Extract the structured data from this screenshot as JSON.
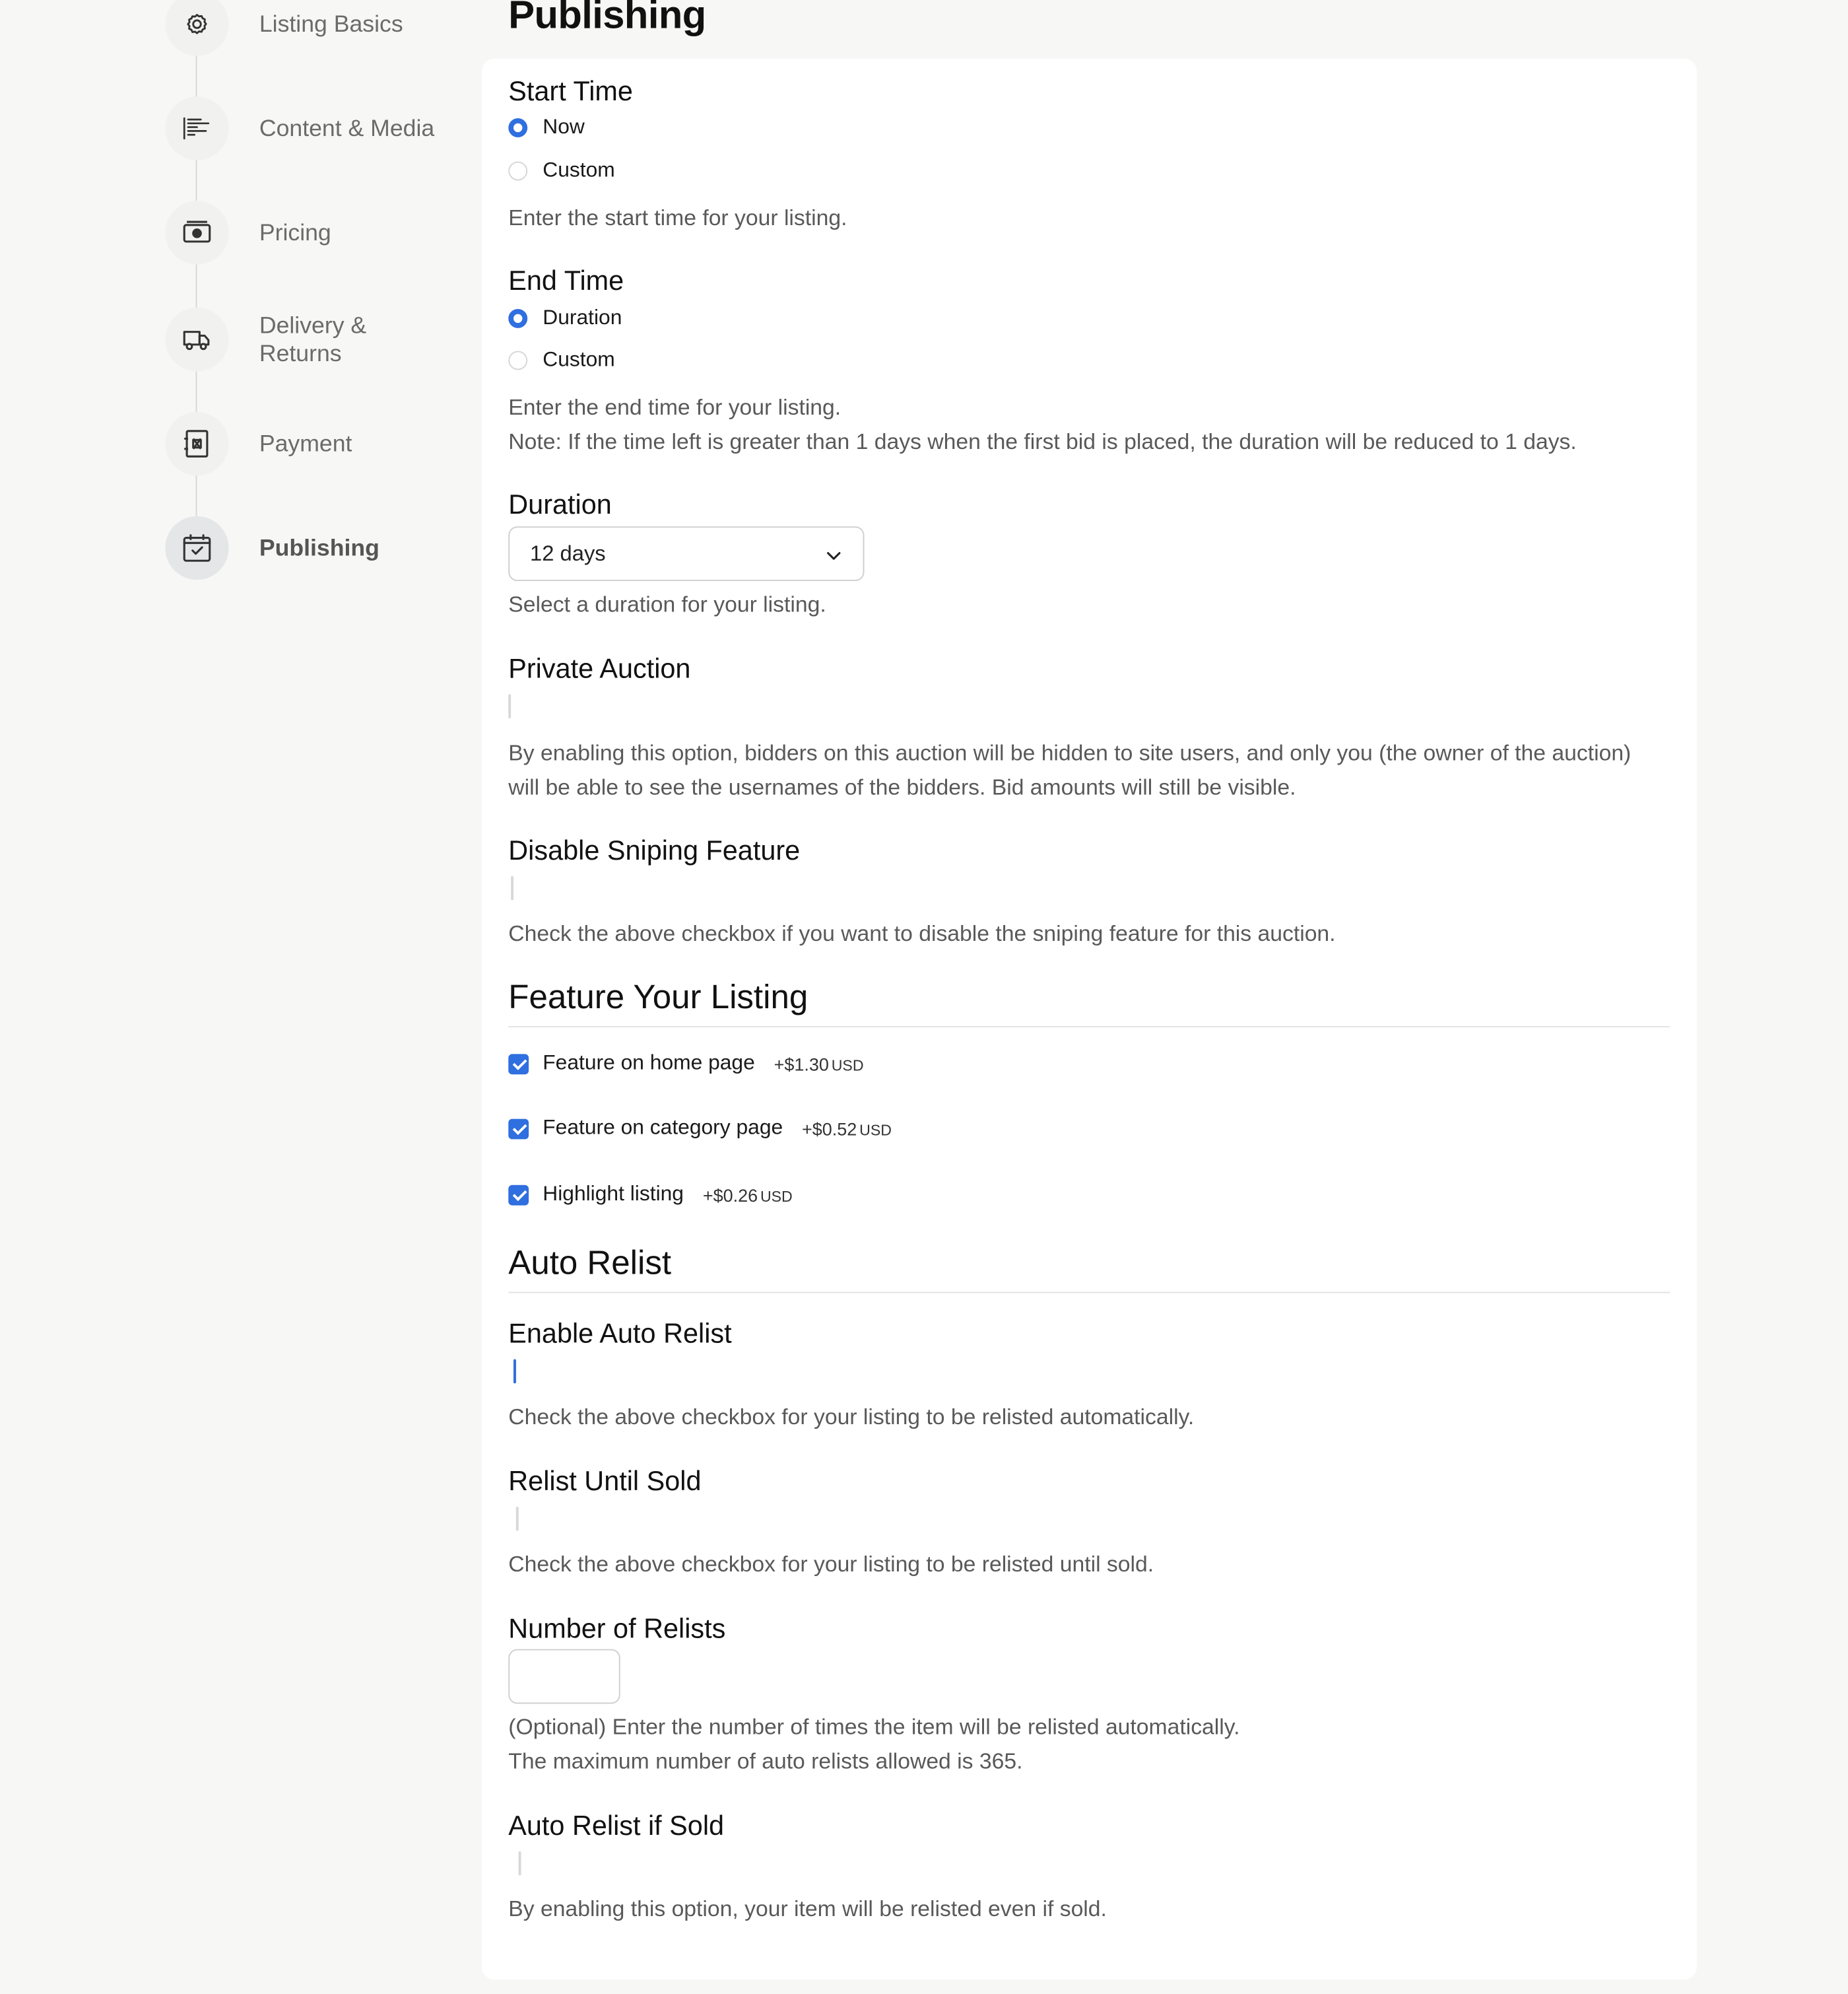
{
  "sidebar": {
    "steps": [
      {
        "label": "Listing Basics",
        "icon": "gear-icon"
      },
      {
        "label": "Content & Media",
        "icon": "content-lines-icon"
      },
      {
        "label": "Pricing",
        "icon": "cash-icon"
      },
      {
        "label": "Delivery & Returns",
        "icon": "truck-icon"
      },
      {
        "label": "Payment",
        "icon": "payment-icon"
      },
      {
        "label": "Publishing",
        "icon": "calendar-check-icon",
        "active": true
      }
    ]
  },
  "page": {
    "title": "Publishing"
  },
  "start_time": {
    "label": "Start Time",
    "options": [
      "Now",
      "Custom"
    ],
    "selected": "Now",
    "help": "Enter the start time for your listing."
  },
  "end_time": {
    "label": "End Time",
    "options": [
      "Duration",
      "Custom"
    ],
    "selected": "Duration",
    "help": "Enter the end time for your listing.",
    "note": "Note: If the time left is greater than 1 days when the first bid is placed, the duration will be reduced to 1 days."
  },
  "duration": {
    "label": "Duration",
    "value": "12 days",
    "help": "Select a duration for your listing."
  },
  "private_auction": {
    "label": "Private Auction",
    "checked": false,
    "help": "By enabling this option, bidders on this auction will be hidden to site users, and only you (the owner of the auction) will be able to see the usernames of the bidders. Bid amounts will still be visible."
  },
  "disable_sniping": {
    "label": "Disable Sniping Feature",
    "checked": false,
    "help": "Check the above checkbox if you want to disable the sniping feature for this auction."
  },
  "feature_listing": {
    "heading": "Feature Your Listing",
    "options": [
      {
        "label": "Feature on home page",
        "price": "+$1.30",
        "currency": "USD",
        "checked": true
      },
      {
        "label": "Feature on category page",
        "price": "+$0.52",
        "currency": "USD",
        "checked": true
      },
      {
        "label": "Highlight listing",
        "price": "+$0.26",
        "currency": "USD",
        "checked": true
      }
    ]
  },
  "auto_relist": {
    "heading": "Auto Relist",
    "enable": {
      "label": "Enable Auto Relist",
      "checked": true,
      "help": "Check the above checkbox for your listing to be relisted automatically."
    },
    "until_sold": {
      "label": "Relist Until Sold",
      "checked": false,
      "help": "Check the above checkbox for your listing to be relisted until sold."
    },
    "number": {
      "label": "Number of Relists",
      "value": "",
      "help1": "(Optional) Enter the number of times the item will be relisted automatically.",
      "help2": "The maximum number of auto relists allowed is 365."
    },
    "if_sold": {
      "label": "Auto Relist if Sold",
      "checked": false,
      "help": "By enabling this option, your item will be relisted even if sold."
    }
  },
  "colors": {
    "accent": "#2f6fdf",
    "background": "#f7f7f6",
    "panel": "#ffffff"
  }
}
